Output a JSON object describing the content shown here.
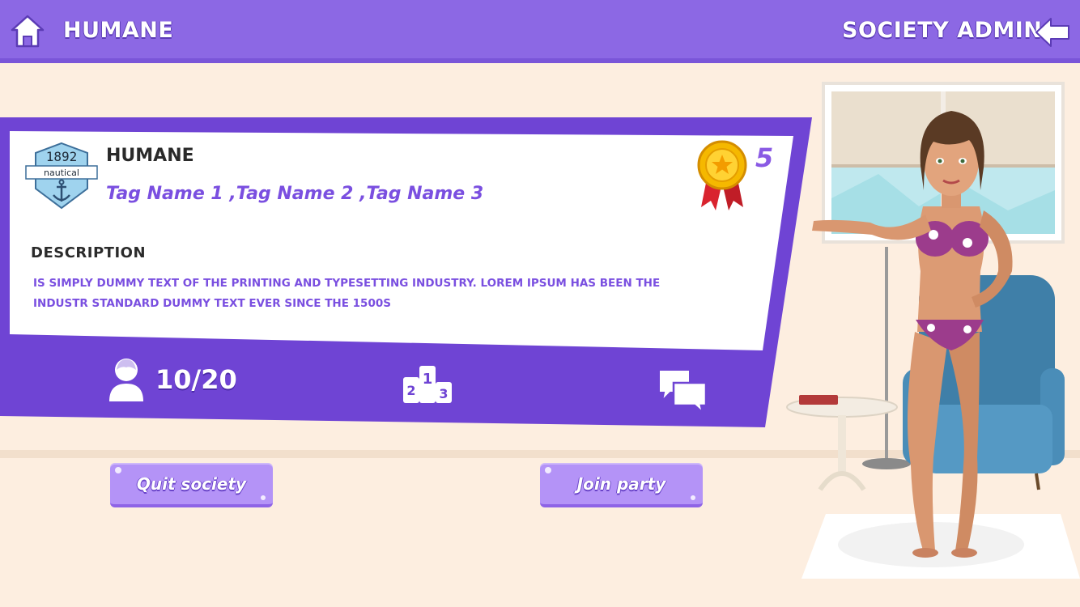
{
  "header": {
    "title": "HUMANE",
    "right_title": "SOCIETY ADMIN"
  },
  "society": {
    "name": "HUMANE",
    "tags": "Tag Name 1  ,Tag Name 2 ,Tag Name 3",
    "emblem": {
      "year": "1892",
      "label": "nautical"
    },
    "medal_count": "5",
    "description_label": "DESCRIPTION",
    "description": "IS SIMPLY DUMMY TEXT OF THE PRINTING AND TYPESETTING INDUSTRY. LOREM IPSUM HAS BEEN THE INDUSTR STANDARD DUMMY TEXT EVER SINCE THE 1500S",
    "members": "10/20",
    "rank_digits": [
      "2",
      "1",
      "3"
    ]
  },
  "buttons": {
    "quit": "Quit society",
    "join": "Join party"
  },
  "icons": {
    "home": "home-icon",
    "back": "back-arrow-icon",
    "medal": "medal-icon",
    "members": "user-icon",
    "rank": "podium-icon",
    "chat": "chat-icon"
  },
  "colors": {
    "topbar": "#8c68e4",
    "panel": "#6f44d4",
    "accent_text": "#7a4fe0",
    "button": "#b493f7",
    "background": "#fdeee0"
  }
}
